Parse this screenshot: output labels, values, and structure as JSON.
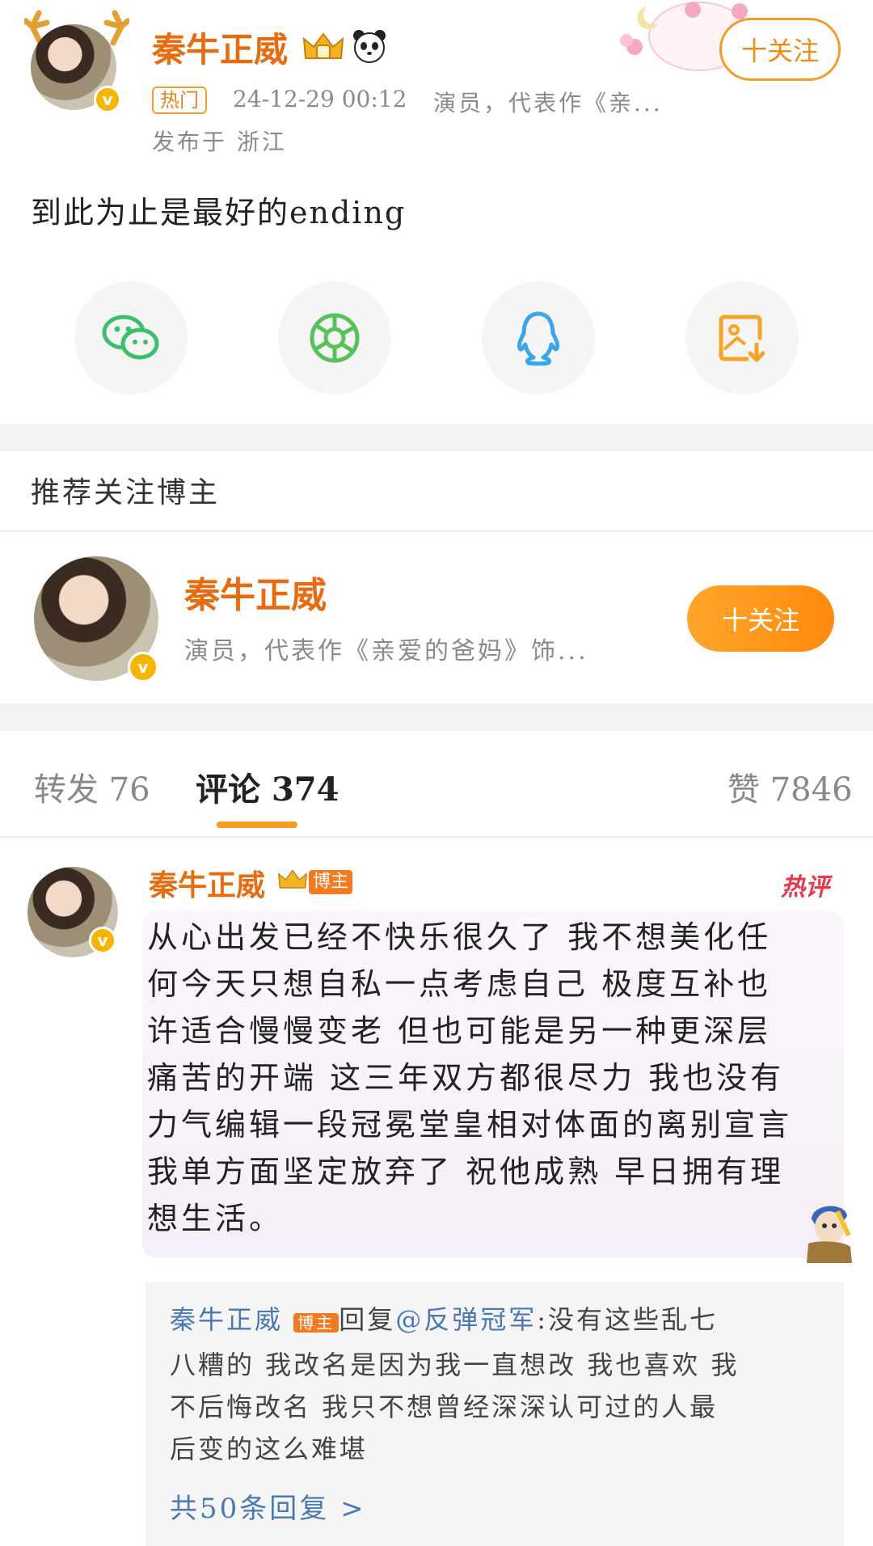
{
  "post": {
    "username": "秦牛正威",
    "hot_tag": "热门",
    "timestamp": "24-12-29 00:12",
    "description": "演员，代表作《亲...",
    "location": "发布于 浙江",
    "follow_label": "十关注",
    "content": "到此为止是最好的ending"
  },
  "share": {
    "items": [
      {
        "name": "wechat",
        "icon": "wechat-icon",
        "color": "#3cbf6a"
      },
      {
        "name": "moments",
        "icon": "moments-icon",
        "color": "#57c15a"
      },
      {
        "name": "qq",
        "icon": "qq-icon",
        "color": "#3aa6e8"
      },
      {
        "name": "save-image",
        "icon": "save-image-icon",
        "color": "#f5a524"
      }
    ]
  },
  "recommend": {
    "title": "推荐关注博主",
    "username": "秦牛正威",
    "description": "演员，代表作《亲爱的爸妈》饰...",
    "follow_label": "十关注"
  },
  "tabs": {
    "repost_label": "转发",
    "repost_count": "76",
    "comment_label": "评论",
    "comment_count": "374",
    "like_label": "赞",
    "like_count": "7846"
  },
  "comment": {
    "username": "秦牛正威",
    "badge": "博主",
    "hot_label": "热评",
    "lines": [
      "从心出发已经不快乐很久了 我不想美化任",
      "何今天只想自私一点考虑自己 极度互补也",
      "许适合慢慢变老 但也可能是另一种更深层",
      "痛苦的开端 这三年双方都很尽力 我也没有",
      "力气编辑一段冠冕堂皇相对体面的离别宣言",
      "我单方面坚定放弃了 祝他成熟 早日拥有理",
      "想生活。"
    ]
  },
  "reply": {
    "username": "秦牛正威",
    "badge": "博主",
    "reply_word": "回复",
    "mention": "@反弹冠军",
    "lines": [
      ":没有这些乱七",
      "八糟的 我改名是因为我一直想改 我也喜欢 我",
      "不后悔改名 我只不想曾经深深认可过的人最",
      "后变的这么难堪"
    ],
    "more": "共50条回复 >"
  },
  "colors": {
    "accent": "#f08a17",
    "name": "#e86b10",
    "link": "#4a78b5"
  }
}
